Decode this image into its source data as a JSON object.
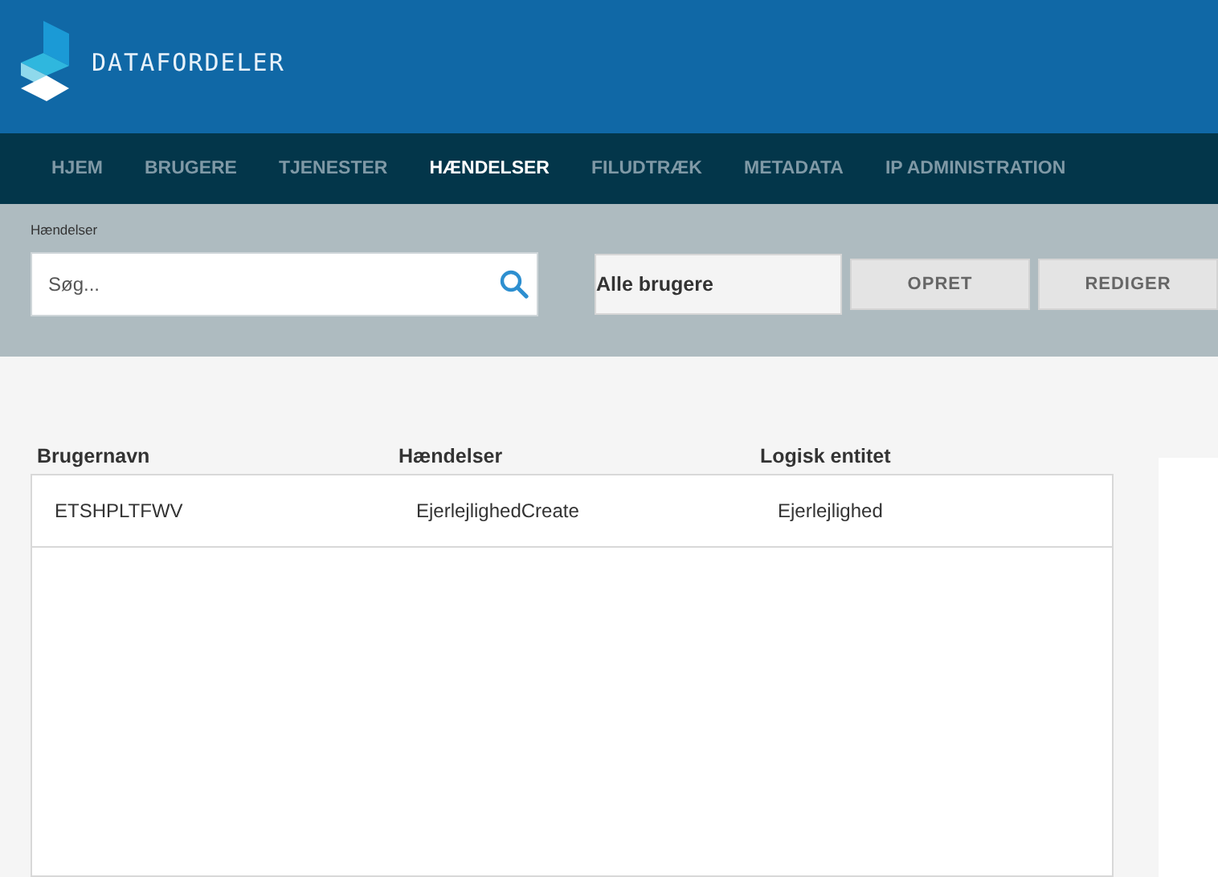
{
  "header": {
    "logo_text": "DATAFORDELER"
  },
  "nav": {
    "items": [
      {
        "label": "HJEM",
        "selected": false
      },
      {
        "label": "BRUGERE",
        "selected": false
      },
      {
        "label": "TJENESTER",
        "selected": false
      },
      {
        "label": "HÆNDELSER",
        "selected": true
      },
      {
        "label": "FILUDTRÆK",
        "selected": false
      },
      {
        "label": "METADATA",
        "selected": false
      },
      {
        "label": "IP ADMINISTRATION",
        "selected": false
      }
    ]
  },
  "toolbar": {
    "breadcrumb": "Hændelser",
    "search": {
      "placeholder": "Søg..."
    },
    "user_filter": "Alle brugere",
    "buttons": [
      "OPRET",
      "REDIGER"
    ]
  },
  "table": {
    "columns": [
      "Brugernavn",
      "Hændelser",
      "Logisk entitet"
    ],
    "rows": [
      [
        "ETSHPLTFWV",
        "EjerlejlighedCreate",
        "Ejerlejlighed"
      ]
    ]
  }
}
